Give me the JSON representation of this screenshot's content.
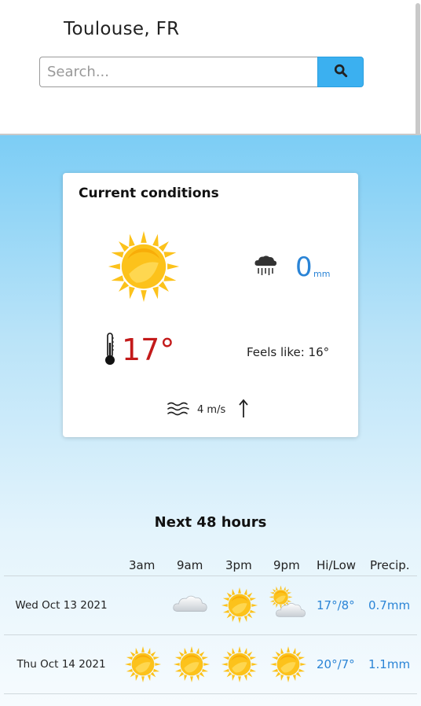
{
  "header": {
    "city": "Toulouse, FR",
    "search_placeholder": "Search...",
    "search_icon": "search-icon"
  },
  "current": {
    "title": "Current conditions",
    "condition_icon": "sun-icon",
    "precip_icon": "rain-cloud-icon",
    "precip_value": "0",
    "precip_unit": "mm",
    "temperature": "17°",
    "feels_like": "Feels like: 16°",
    "wind_icon": "wind-icon",
    "wind_speed": "4 m/s",
    "wind_direction_icon": "arrow-up-icon"
  },
  "forecast": {
    "title": "Next 48 hours",
    "columns": [
      "3am",
      "9am",
      "3pm",
      "9pm",
      "Hi/Low",
      "Precip."
    ],
    "rows": [
      {
        "date": "Wed Oct 13 2021",
        "icons": [
          "",
          "cloud-icon",
          "sun-icon",
          "sun-cloud-icon"
        ],
        "hilow": "17°/8°",
        "precip": "0.7mm"
      },
      {
        "date": "Thu Oct 14 2021",
        "icons": [
          "sun-icon",
          "sun-icon",
          "sun-icon",
          "sun-icon"
        ],
        "hilow": "20°/7°",
        "precip": "1.1mm"
      }
    ]
  },
  "colors": {
    "accent": "#3bb0f0",
    "temp": "#c31a1a",
    "precip": "#2a84d6",
    "sun": "#fcc21b"
  }
}
